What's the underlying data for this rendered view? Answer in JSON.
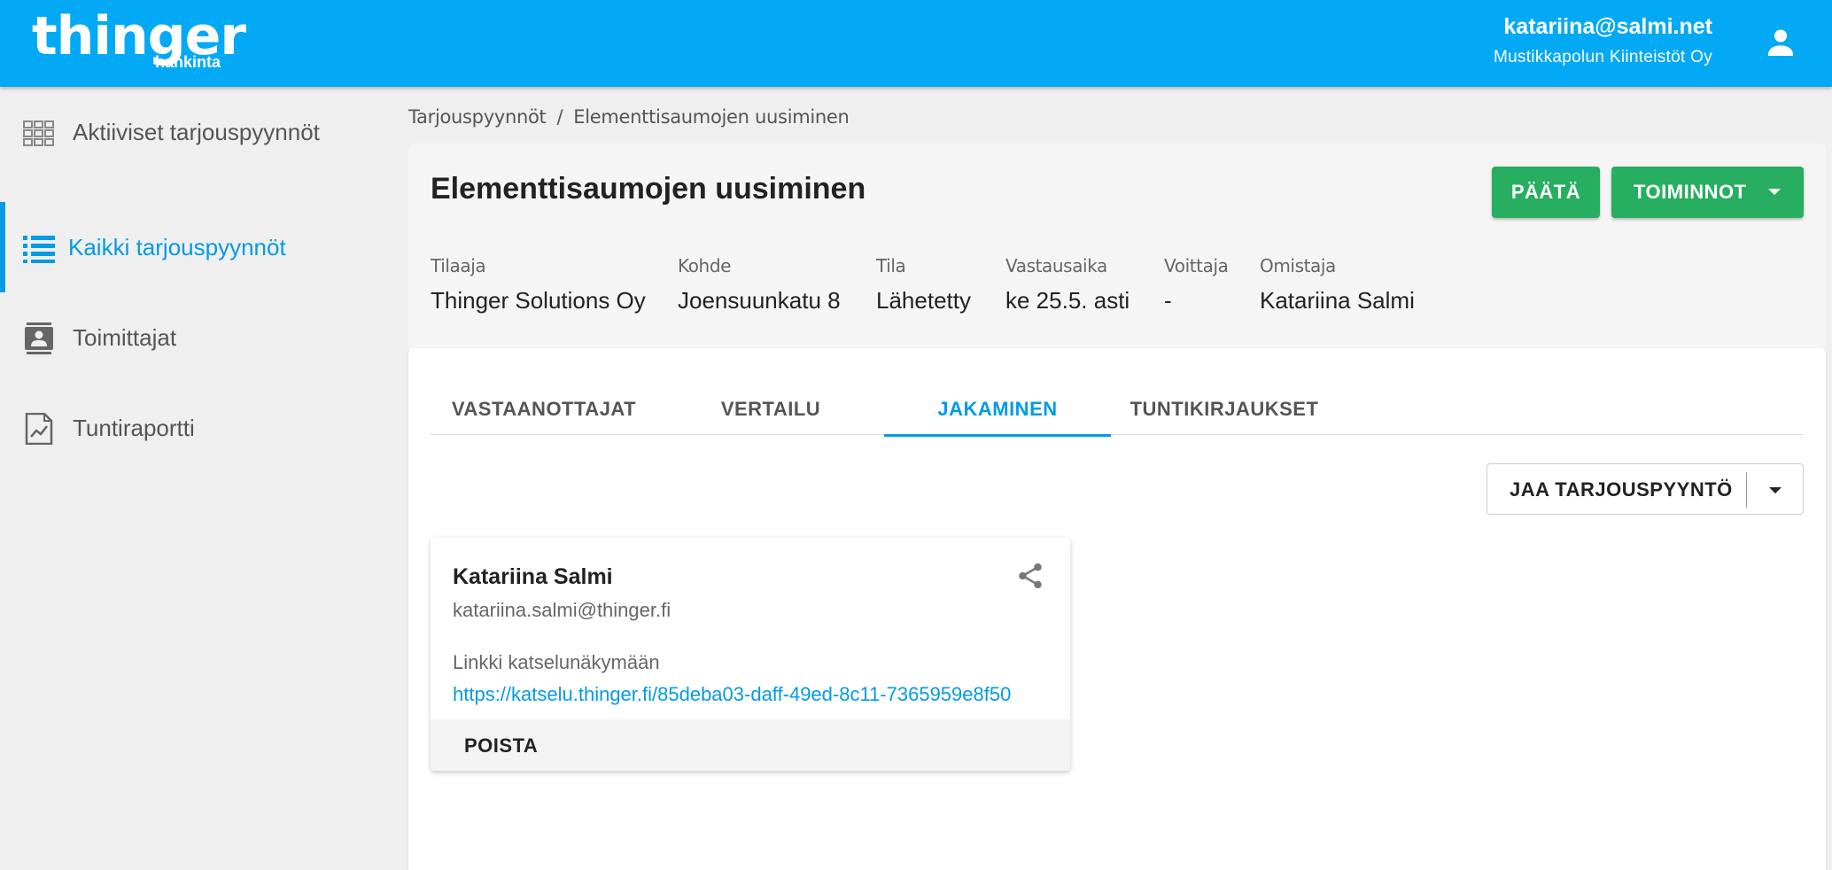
{
  "topbar": {
    "logo_main": "thinger",
    "logo_sub": "hankinta",
    "user_email": "katariina@salmi.net",
    "user_org": "Mustikkapolun Kiinteistöt Oy",
    "account_icon": "account-icon"
  },
  "sidebar": {
    "items": [
      {
        "label": "Aktiiviset tarjouspyynnöt",
        "icon": "grid-icon",
        "active": false
      },
      {
        "label": "Kaikki tarjouspyynnöt",
        "icon": "list-icon",
        "active": true
      },
      {
        "label": "Toimittajat",
        "icon": "contacts-icon",
        "active": false
      },
      {
        "label": "Tuntiraportti",
        "icon": "report-icon",
        "active": false
      }
    ]
  },
  "breadcrumb": {
    "parent": "Tarjouspyynnöt",
    "separator": "/",
    "current": "Elementtisaumojen uusiminen"
  },
  "header": {
    "title": "Elementtisaumojen uusiminen",
    "close_button": "PÄÄTÄ",
    "actions_button": "TOIMINNOT",
    "meta": [
      {
        "key": "Tilaaja",
        "value": "Thinger Solutions Oy"
      },
      {
        "key": "Kohde",
        "value": "Joensuunkatu 8"
      },
      {
        "key": "Tila",
        "value": "Lähetetty"
      },
      {
        "key": "Vastausaika",
        "value": "ke 25.5. asti"
      },
      {
        "key": "Voittaja",
        "value": "-"
      },
      {
        "key": "Omistaja",
        "value": "Katariina Salmi"
      }
    ]
  },
  "tabs": [
    {
      "label": "VASTAANOTTAJAT",
      "active": false
    },
    {
      "label": "VERTAILU",
      "active": false
    },
    {
      "label": "JAKAMINEN",
      "active": true
    },
    {
      "label": "TUNTIKIRJAUKSET",
      "active": false
    }
  ],
  "share_button": {
    "label": "JAA TARJOUSPYYNTÖ"
  },
  "share_card": {
    "name": "Katariina Salmi",
    "email": "katariina.salmi@thinger.fi",
    "link_label": "Linkki katselunäkymään",
    "link_url": "https://katselu.thinger.fi/85deba03-daff-49ed-8c11-7365959e8f50",
    "delete_label": "POISTA"
  },
  "colors": {
    "primary": "#03a9f4",
    "accent": "#039be5",
    "green": "#27ae60"
  }
}
